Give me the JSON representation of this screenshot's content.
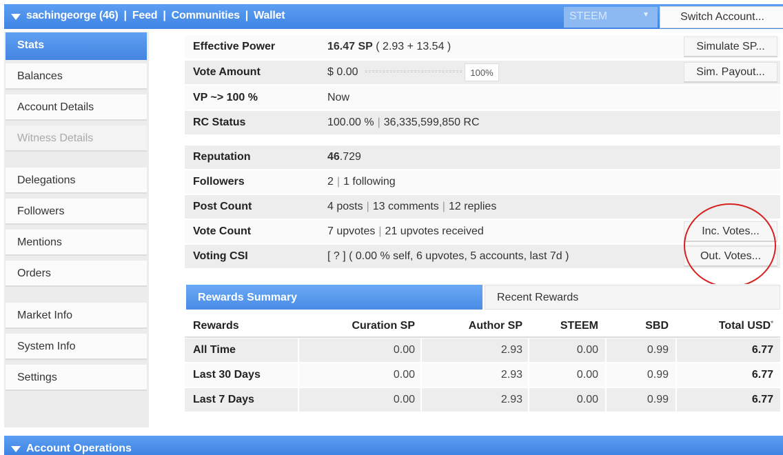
{
  "topbar": {
    "username": "sachingeorge (46)",
    "nav": [
      "Feed",
      "Communities",
      "Wallet"
    ],
    "chain_select": "STEEM",
    "switch_account": "Switch Account..."
  },
  "sidebar": {
    "items": [
      {
        "label": "Stats",
        "active": true
      },
      {
        "label": "Balances"
      },
      {
        "label": "Account Details"
      },
      {
        "label": "Witness Details",
        "disabled": true
      },
      {
        "label": "Delegations"
      },
      {
        "label": "Followers"
      },
      {
        "label": "Mentions"
      },
      {
        "label": "Orders"
      },
      {
        "label": "Market Info"
      },
      {
        "label": "System Info"
      },
      {
        "label": "Settings"
      }
    ]
  },
  "stats": {
    "effective_power": {
      "label": "Effective Power",
      "value_bold": "16.47 SP",
      "value_rest": " ( 2.93 + 13.54 )",
      "button": "Simulate SP..."
    },
    "vote_amount": {
      "label": "Vote Amount",
      "value": "$ 0.00",
      "percent": "100%",
      "button": "Sim. Payout..."
    },
    "vp": {
      "label": "VP ~> 100 %",
      "value": "Now"
    },
    "rc": {
      "label": "RC Status",
      "value1": "100.00 %",
      "value2": "36,335,599,850 RC"
    },
    "reputation": {
      "label": "Reputation",
      "value_bold": "46",
      "value_rest": ".729"
    },
    "followers": {
      "label": "Followers",
      "value1": "2",
      "value2": "1 following"
    },
    "post_count": {
      "label": "Post Count",
      "value1": "4 posts",
      "value2": "13 comments",
      "value3": "12 replies"
    },
    "vote_count": {
      "label": "Vote Count",
      "value1": "7 upvotes",
      "value2": "21 upvotes received",
      "button": "Inc. Votes..."
    },
    "voting_csi": {
      "label": "Voting CSI",
      "value": "[ ? ] ( 0.00 % self, 6 upvotes, 5 accounts, last 7d )",
      "button": "Out. Votes..."
    }
  },
  "rewards": {
    "tabs": [
      "Rewards Summary",
      "Recent Rewards"
    ],
    "headers": [
      "Rewards",
      "Curation SP",
      "Author SP",
      "STEEM",
      "SBD",
      "Total USD"
    ],
    "header_mark": "*",
    "rows": [
      [
        "All Time",
        "0.00",
        "2.93",
        "0.00",
        "0.99",
        "6.77"
      ],
      [
        "Last 30 Days",
        "0.00",
        "2.93",
        "0.00",
        "0.99",
        "6.77"
      ],
      [
        "Last 7 Days",
        "0.00",
        "2.93",
        "0.00",
        "0.99",
        "6.77"
      ]
    ]
  },
  "bottombar": {
    "title": "Account Operations"
  },
  "colors": {
    "accent": "#4a8ce6",
    "annotation": "#d61f1f"
  }
}
